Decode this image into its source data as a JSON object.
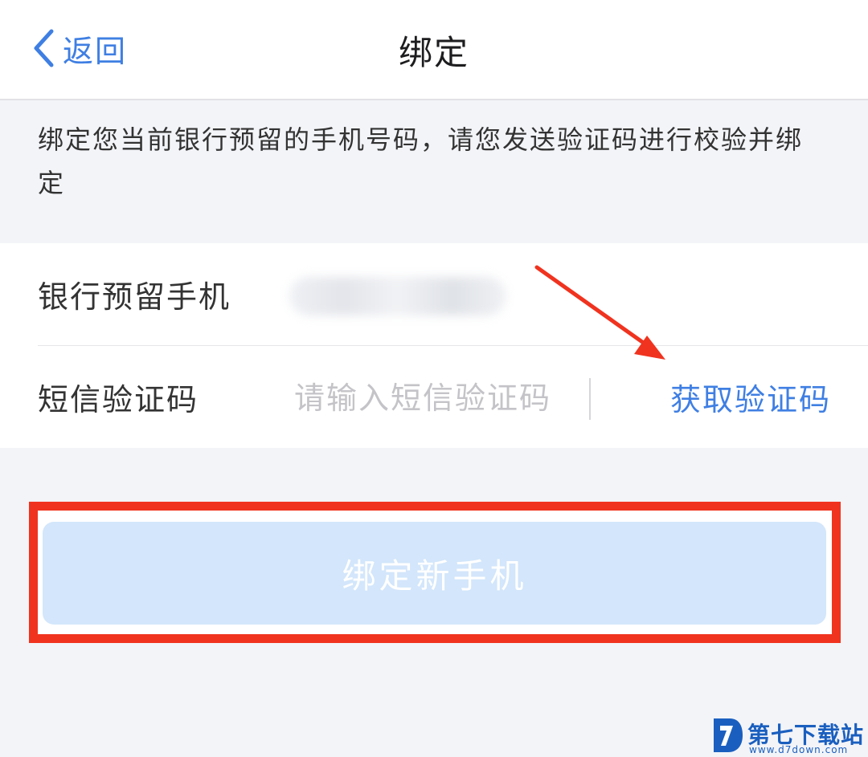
{
  "nav": {
    "back_label": "返回",
    "title": "绑定"
  },
  "description": "绑定您当前银行预留的手机号码，请您发送验证码进行校验并绑定",
  "form": {
    "phone_label": "银行预留手机",
    "code_label": "短信验证码",
    "code_placeholder": "请输入短信验证码",
    "get_code_label": "获取验证码"
  },
  "bind_button_label": "绑定新手机",
  "watermark": {
    "title": "第七下载站",
    "url": "www.d7down.com"
  },
  "colors": {
    "accent": "#3f7fe3",
    "button_disabled": "#d3e6fb",
    "annotation_red": "#f0331f",
    "background": "#f3f4f8"
  },
  "icons": {
    "back": "chevron-left-icon",
    "arrow": "red-arrow-annotation-icon",
    "logo": "d7-logo-icon"
  }
}
